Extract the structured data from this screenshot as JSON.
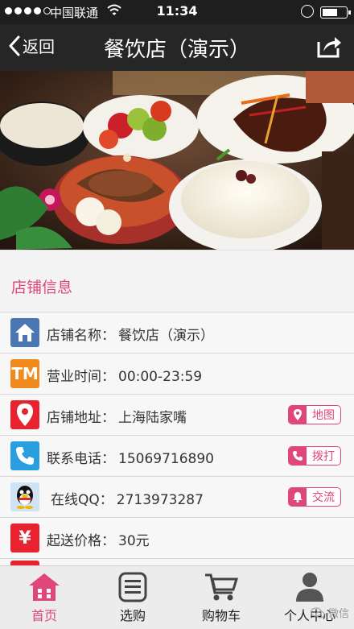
{
  "status_bar": {
    "carrier": "中国联通",
    "time": "11:34",
    "signal_icon": "signal-dots-icon",
    "wifi_icon": "wifi-icon",
    "battery_icon": "battery-icon"
  },
  "nav": {
    "back_label": "返回",
    "title": "餐饮店（演示）",
    "share_icon": "share-icon"
  },
  "banner": {
    "image_icon": "food-photo"
  },
  "section": {
    "title": "店铺信息"
  },
  "info": {
    "name": {
      "label": "店铺名称：",
      "value": "餐饮店（演示）",
      "icon": "home-icon",
      "color": "#4a77b4"
    },
    "hours": {
      "label": "营业时间：",
      "value": "00:00-23:59",
      "icon": "tm-icon",
      "icon_text": "TM",
      "color": "#f08a1c"
    },
    "address": {
      "label": "店铺地址：",
      "value": "上海陆家嘴",
      "icon": "location-pin-icon",
      "color": "#e8232f",
      "action": "地图"
    },
    "phone": {
      "label": "联系电话：",
      "value": "15069716890",
      "icon": "phone-icon",
      "color": "#2a9fe0",
      "action": "拨打"
    },
    "qq": {
      "label": "在线QQ：",
      "value": "2713973287",
      "icon": "qq-penguin-icon",
      "color": "#7fb3e0",
      "action": "交流"
    },
    "min_price": {
      "label": "起送价格：",
      "value": "30元",
      "icon": "yen-icon",
      "icon_text": "¥",
      "color": "#e8232f"
    }
  },
  "tabs": [
    {
      "label": "首页",
      "icon": "home-icon"
    },
    {
      "label": "选购",
      "icon": "list-icon"
    },
    {
      "label": "购物车",
      "icon": "cart-icon"
    },
    {
      "label": "个人中心",
      "icon": "user-icon"
    }
  ],
  "watermark": {
    "text": "微信"
  },
  "colors": {
    "accent": "#e0457b",
    "navbar": "#262626",
    "statusbar": "#1e1e1e"
  }
}
